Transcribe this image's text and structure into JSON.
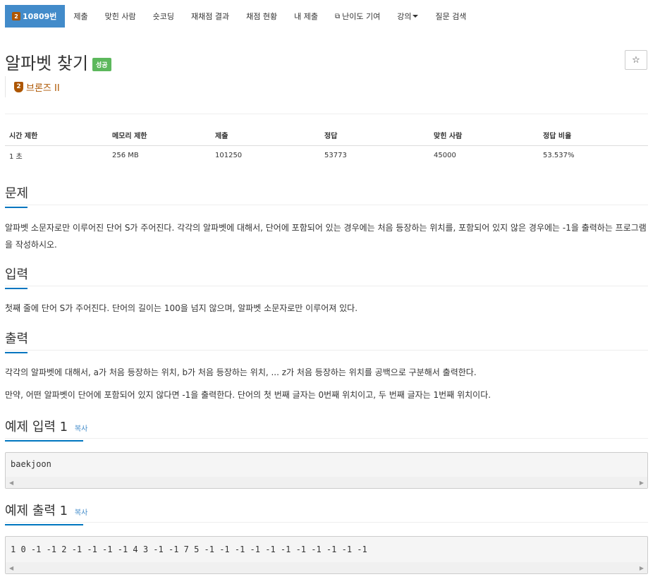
{
  "nav": {
    "problem_tab": "10809번",
    "tier_num": "2",
    "items": [
      "제출",
      "맞힌 사람",
      "숏코딩",
      "재채점 결과",
      "채점 현황",
      "내 제출",
      "난이도 기여",
      "강의",
      "질문 검색"
    ],
    "ext_icon": "external-link-icon"
  },
  "problem": {
    "title": "알파벳 찾기",
    "status_label": "성공",
    "star": "☆",
    "tier_num": "2",
    "tier_name": "브론즈 II",
    "tier_color": "#ad5600"
  },
  "info_table": {
    "headers": [
      "시간 제한",
      "메모리 제한",
      "제출",
      "정답",
      "맞힌 사람",
      "정답 비율"
    ],
    "values": [
      "1 초",
      "256 MB",
      "101250",
      "53773",
      "45000",
      "53.537%"
    ]
  },
  "sections": {
    "problem_heading": "문제",
    "problem_text": "알파벳 소문자로만 이루어진 단어 S가 주어진다. 각각의 알파벳에 대해서, 단어에 포함되어 있는 경우에는 처음 등장하는 위치를, 포함되어 있지 않은 경우에는 -1을 출력하는 프로그램을 작성하시오.",
    "input_heading": "입력",
    "input_text": "첫째 줄에 단어 S가 주어진다. 단어의 길이는 100을 넘지 않으며, 알파벳 소문자로만 이루어져 있다.",
    "output_heading": "출력",
    "output_text1": "각각의 알파벳에 대해서, a가 처음 등장하는 위치, b가 처음 등장하는 위치, ... z가 처음 등장하는 위치를 공백으로 구분해서 출력한다.",
    "output_text2": "만약, 어떤 알파벳이 단어에 포함되어 있지 않다면 -1을 출력한다. 단어의 첫 번째 글자는 0번째 위치이고, 두 번째 글자는 1번째 위치이다.",
    "sample_input_heading": "예제 입력 1",
    "sample_input": "baekjoon",
    "sample_output_heading": "예제 출력 1",
    "sample_output": "1 0 -1 -1 2 -1 -1 -1 -1 4 3 -1 -1 7 5 -1 -1 -1 -1 -1 -1 -1 -1 -1 -1 -1",
    "copy_label": "복사"
  },
  "colors": {
    "accent": "#428bca",
    "success": "#5cb85c",
    "heading_underline": "#0076c0"
  }
}
